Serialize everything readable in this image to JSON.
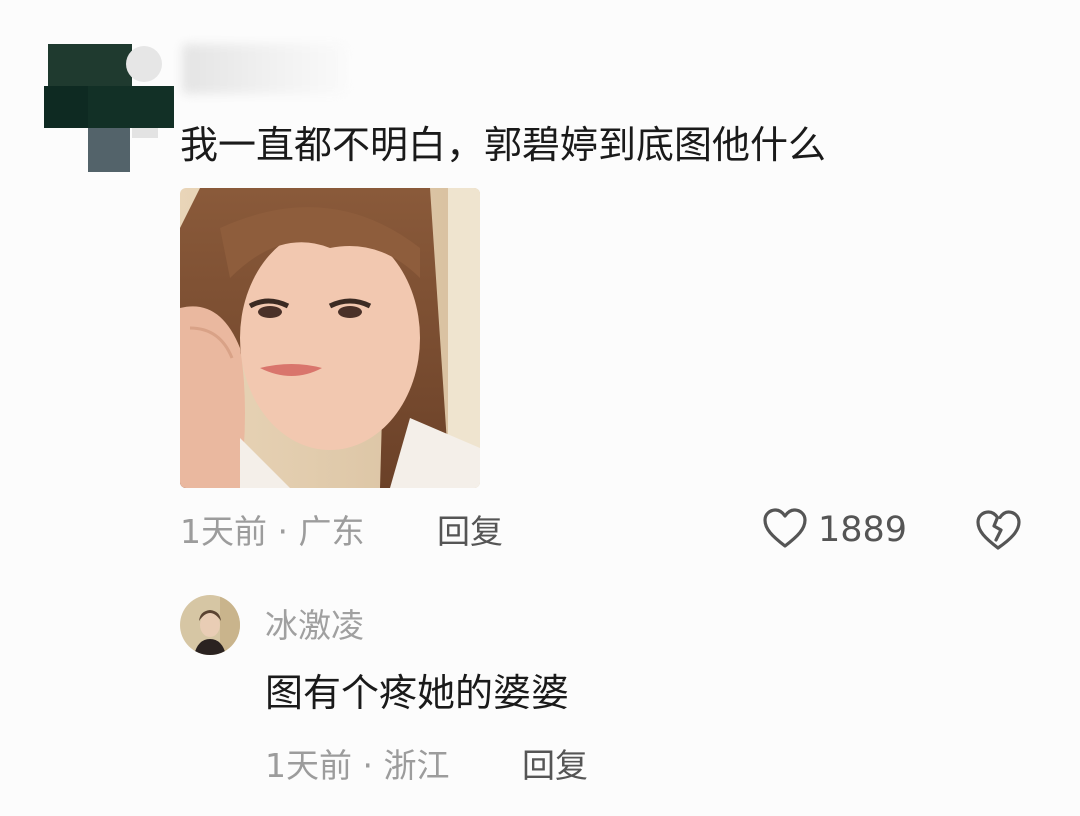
{
  "comment": {
    "text": "我一直都不明白，郭碧婷到底图他什么",
    "time": "1天前",
    "separator": "·",
    "location": "广东",
    "reply_label": "回复",
    "likes": "1889"
  },
  "reply": {
    "username": "冰激凌",
    "text": "图有个疼她的婆婆",
    "time": "1天前",
    "separator": "·",
    "location": "浙江",
    "reply_label": "回复"
  },
  "icons": {
    "like": "heart-outline-icon",
    "dislike": "broken-heart-icon"
  },
  "colors": {
    "background": "#fcfcfc",
    "text": "#1a1a1a",
    "meta": "#9c9c9c",
    "icon": "#555555"
  }
}
